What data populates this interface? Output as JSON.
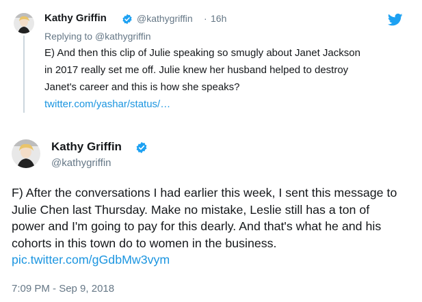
{
  "colors": {
    "text": "#14171a",
    "muted": "#657786",
    "link": "#1b95e0",
    "verified": "#1da1f2",
    "thread_line": "#ccd6dd"
  },
  "icons": {
    "verified": "verified-badge-icon",
    "platform": "twitter-bird-icon"
  },
  "reply_tweet": {
    "author_name": "Kathy Griffin",
    "handle": "@kathygriffin",
    "separator": "·",
    "time": "16h",
    "replying_prefix": "Replying to ",
    "replying_to": "@kathygriffin",
    "text": "E) And then this clip of Julie speaking so smugly about Janet Jackson in 2017 really set me off. Julie knew her husband helped to destroy Janet's career and this is how she speaks?",
    "link": "twitter.com/yashar/status/…"
  },
  "main_tweet": {
    "author_name": "Kathy Griffin",
    "handle": "@kathygriffin",
    "text": "F) After the conversations I had earlier this week, I sent this message to Julie Chen last Thursday. Make no mistake, Leslie still has a ton of power and I'm going to pay for this dearly. And that's what he and his cohorts in this town do to women in the business.",
    "link": "pic.twitter.com/gGdbMw3vym",
    "timestamp": "7:09 PM - Sep 9, 2018"
  }
}
